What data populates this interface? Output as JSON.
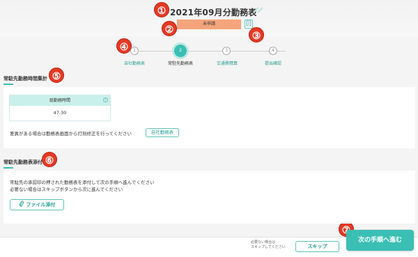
{
  "header": {
    "title": "2021年09月分勤務表",
    "status": "未申請",
    "history_icon": "document-icon"
  },
  "annotations": [
    "①",
    "②",
    "③",
    "④",
    "⑤",
    "⑥",
    "⑦"
  ],
  "steps": [
    {
      "number": "1",
      "label": "自社勤務表"
    },
    {
      "number": "2",
      "label": "常駐先勤務表"
    },
    {
      "number": "3",
      "label": "交通費精算"
    },
    {
      "number": "4",
      "label": "提出確認"
    }
  ],
  "hours_section": {
    "title": "常駐先勤務時間集計",
    "column_header": "総勤務時間",
    "total_hours": "47:30",
    "note": "差異がある場合は勤務表画面から打刻修正を行ってください",
    "link_button": "自社勤務表"
  },
  "attach_section": {
    "title": "常駐先勤務表添付",
    "line1": "常駐先の承認印の押された勤務表を添付して次の手順へ進んでください",
    "line2": "必要ない場合はスキップボタンから次に進んでください",
    "attach_button": "ファイル添付"
  },
  "footer": {
    "skip_note_line1": "必要ない場合は",
    "skip_note_line2": "スキップしてください",
    "skip_button": "スキップ",
    "next_button": "次の手順へ進む"
  },
  "colors": {
    "accent": "#3bbfb4",
    "badge": "#f5a47c",
    "annotation": "#e53a25"
  }
}
